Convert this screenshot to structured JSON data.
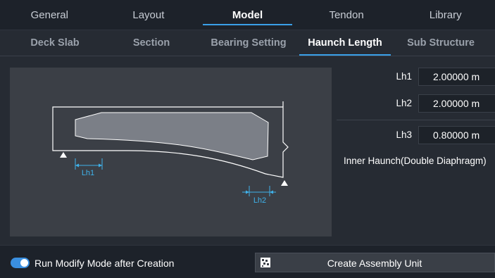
{
  "top_tabs": [
    "General",
    "Layout",
    "Model",
    "Tendon",
    "Library"
  ],
  "active_top_tab": "Model",
  "sub_tabs": [
    "Deck Slab",
    "Section",
    "Bearing Setting",
    "Haunch Length",
    "Sub Structure"
  ],
  "active_sub_tab": "Haunch Length",
  "diagram": {
    "dim1": "Lh1",
    "dim2": "Lh2"
  },
  "fields": [
    {
      "label": "Lh1",
      "value": "2.00000 m"
    },
    {
      "label": "Lh2",
      "value": "2.00000 m"
    },
    {
      "label": "Lh3",
      "value": "0.80000 m"
    }
  ],
  "inner_haunch_label": "Inner Haunch(Double Diaphragm)",
  "bottom": {
    "toggle_label": "Run Modify Mode after Creation",
    "toggle_on": true,
    "create_button": "Create Assembly Unit"
  },
  "colors": {
    "accent": "#3aa0e8",
    "toggle": "#3a8fe0",
    "dimension": "#3fb2ea"
  }
}
